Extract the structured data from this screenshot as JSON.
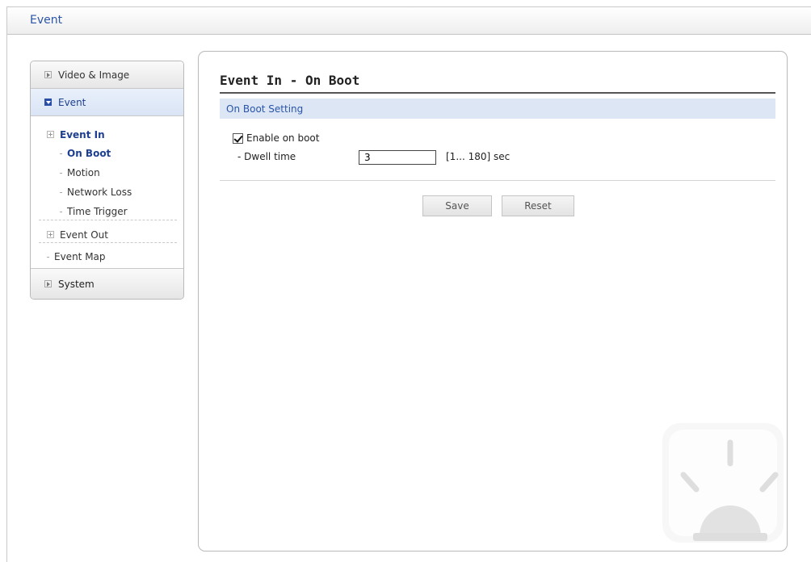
{
  "header": {
    "title": "Event"
  },
  "sidebar": {
    "video_image": "Video & Image",
    "event": "Event",
    "event_in": "Event In",
    "on_boot": "On Boot",
    "motion": "Motion",
    "network_loss": "Network Loss",
    "time_trigger": "Time Trigger",
    "event_out": "Event Out",
    "event_map": "Event Map",
    "system": "System"
  },
  "main": {
    "title": "Event In - On Boot",
    "section": "On Boot Setting",
    "enable_label": "Enable on boot",
    "enable_checked": true,
    "dwell_label": "- Dwell time",
    "dwell_value": "3",
    "dwell_range": "[1... 180] sec",
    "save_label": "Save",
    "reset_label": "Reset"
  },
  "colors": {
    "accent": "#2a55a8",
    "section_bg": "#dde6f5"
  }
}
